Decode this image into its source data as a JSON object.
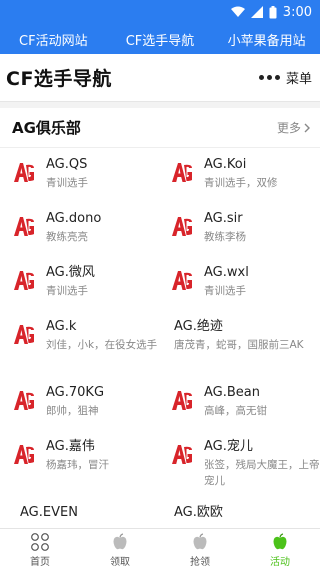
{
  "status_bar": {
    "time": "3:00"
  },
  "top_nav": {
    "tabs": [
      "CF活动网站",
      "CF选手导航",
      "小苹果备用站"
    ]
  },
  "header": {
    "title": "CF选手导航",
    "menu_label": "菜单"
  },
  "club": {
    "title": "AG俱乐部",
    "more_label": "更多",
    "players": [
      {
        "name": "AG.QS",
        "desc": "青训选手"
      },
      {
        "name": "AG.Koi",
        "desc": "青训选手，双修"
      },
      {
        "name": "AG.dono",
        "desc": "教练亮亮"
      },
      {
        "name": "AG.sir",
        "desc": "教练李杨"
      },
      {
        "name": "AG.微风",
        "desc": "青训选手"
      },
      {
        "name": "AG.wxl",
        "desc": "青训选手"
      },
      {
        "name": "AG.k",
        "desc": "刘佳，小k，在役女选手"
      },
      {
        "name": "AG.绝迹",
        "desc": "唐茂青，蛇哥，国服前三AK"
      },
      {
        "name": "AG.70KG",
        "desc": "郎帅，狙神"
      },
      {
        "name": "AG.Bean",
        "desc": "高峰，高无钳"
      },
      {
        "name": "AG.嘉伟",
        "desc": "杨嘉玮，冒汗"
      },
      {
        "name": "AG.宠儿",
        "desc": "张签，残局大魔王，上帝宠儿"
      },
      {
        "name": "AG.EVEN",
        "desc": ""
      },
      {
        "name": "AG.欧欧",
        "desc": ""
      }
    ]
  },
  "bottom_nav": {
    "items": [
      "首页",
      "领取",
      "抢领",
      "活动"
    ]
  },
  "colors": {
    "brand_blue": "#2b7df0",
    "active_green": "#4cc21a",
    "logo_red": "#d8242a"
  }
}
